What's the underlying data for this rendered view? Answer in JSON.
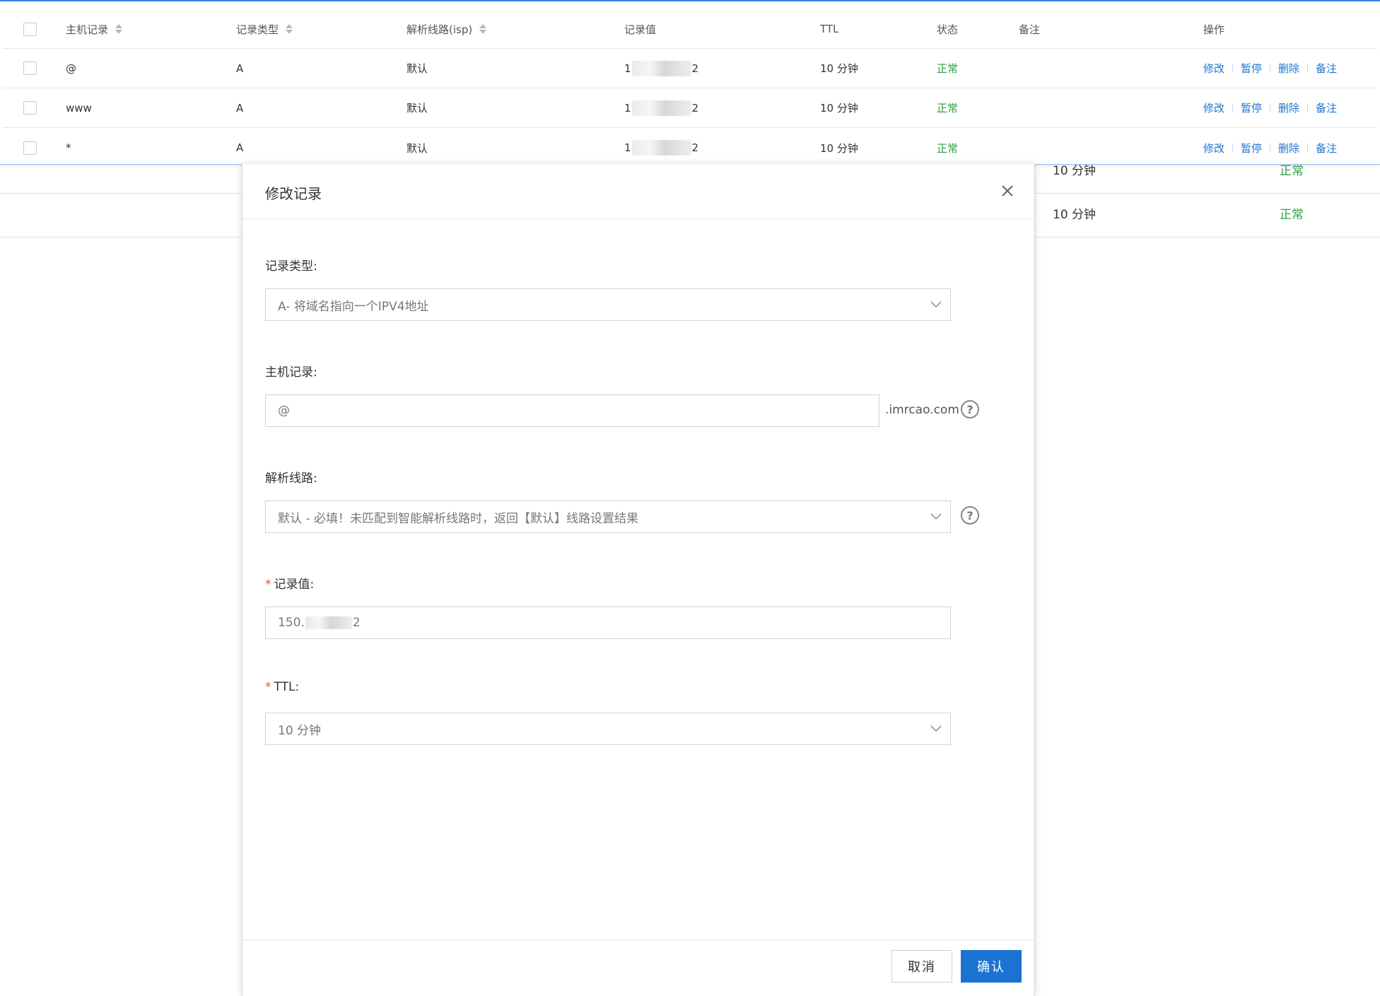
{
  "table": {
    "headers": {
      "host": "主机记录",
      "type": "记录类型",
      "line": "解析线路(isp)",
      "value": "记录值",
      "ttl": "TTL",
      "status": "状态",
      "remark": "备注",
      "ops": "操作"
    },
    "rows": [
      {
        "host": "@",
        "type": "A",
        "line": "默认",
        "value_prefix": "1",
        "value_suffix": "2",
        "ttl": "10 分钟",
        "status": "正常"
      },
      {
        "host": "www",
        "type": "A",
        "line": "默认",
        "value_prefix": "1",
        "value_suffix": "2",
        "ttl": "10 分钟",
        "status": "正常"
      },
      {
        "host": "*",
        "type": "A",
        "line": "默认",
        "value_prefix": "1",
        "value_suffix": "2",
        "ttl": "10 分钟",
        "status": "正常"
      }
    ],
    "actions": {
      "edit": "修改",
      "pause": "暂停",
      "delete": "删除",
      "remark": "备注"
    }
  },
  "background_rows": [
    {
      "ttl": "10 分钟",
      "status": "正常"
    },
    {
      "ttl": "10 分钟",
      "status": "正常"
    }
  ],
  "modal": {
    "title": "修改记录",
    "fields": {
      "record_type": {
        "label": "记录类型:",
        "value": "A- 将域名指向一个IPV4地址"
      },
      "host": {
        "label": "主机记录:",
        "value": "@",
        "suffix": ".imrcao.com"
      },
      "line": {
        "label": "解析线路:",
        "value": "默认 - 必填！未匹配到智能解析线路时，返回【默认】线路设置结果"
      },
      "record_value": {
        "required_mark": "*",
        "label": "记录值:",
        "value_prefix": "150.",
        "value_suffix": "2"
      },
      "ttl": {
        "required_mark": "*",
        "label": "TTL:",
        "value": "10 分钟"
      }
    },
    "buttons": {
      "cancel": "取消",
      "confirm": "确认"
    },
    "help_glyph": "?"
  },
  "colors": {
    "accent": "#1b73d1",
    "link": "#1f74cf",
    "status_ok": "#2e9e3f",
    "required": "#e74c3c"
  }
}
